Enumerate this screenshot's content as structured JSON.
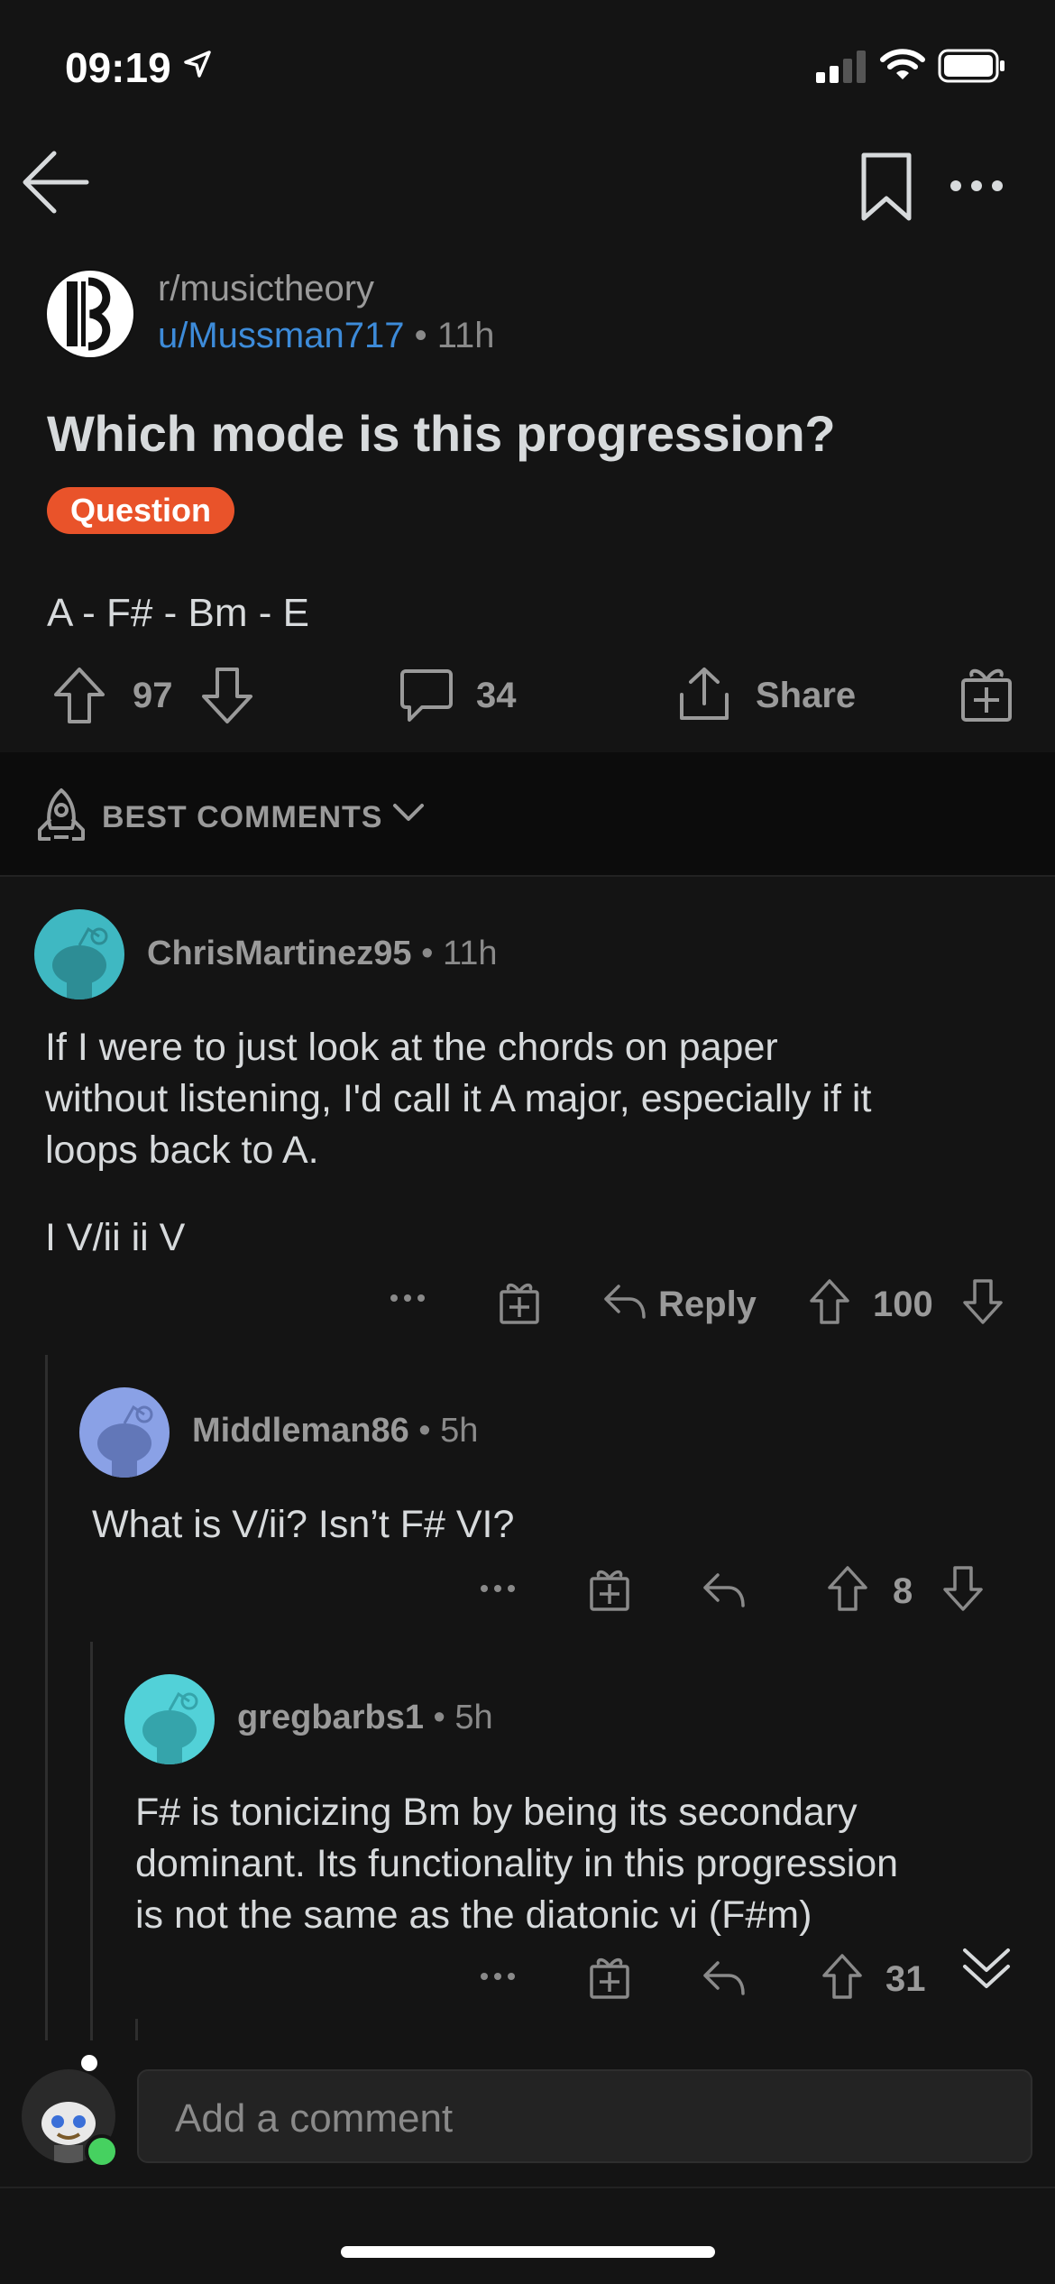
{
  "status_bar": {
    "time": "09:19"
  },
  "post": {
    "subreddit": "r/musictheory",
    "author": "u/Mussman717",
    "age": " • 11h",
    "title": "Which mode is this progression?",
    "flair": "Question",
    "body": "A - F# - Bm - E",
    "upvotes": "97",
    "comments": "34",
    "share_label": "Share"
  },
  "sort": {
    "label": "BEST COMMENTS"
  },
  "comments": [
    {
      "author": "ChrisMartinez95",
      "age": " • 11h",
      "lines": [
        "If I were to just look at the chords on paper",
        "without listening, I'd call it A major, especially if it",
        "loops back to A."
      ],
      "extra": "I V/ii ii V",
      "reply_label": "Reply",
      "score": "100"
    },
    {
      "author": "Middleman86",
      "age": " • 5h",
      "lines": [
        "What is V/ii? Isn’t F# VI?"
      ],
      "score": "8"
    },
    {
      "author": "gregbarbs1",
      "age": " • 5h",
      "lines": [
        "F# is tonicizing Bm by being its secondary",
        "dominant. Its functionality in this progression",
        "is not the same as the diatonic vi (F#m)"
      ],
      "score": "31"
    }
  ],
  "comment_input": {
    "placeholder": "Add a comment"
  },
  "colors": {
    "background": "#141414",
    "username_link": "#3d8bd9",
    "flair": "#e9532a",
    "online": "#46d160"
  }
}
